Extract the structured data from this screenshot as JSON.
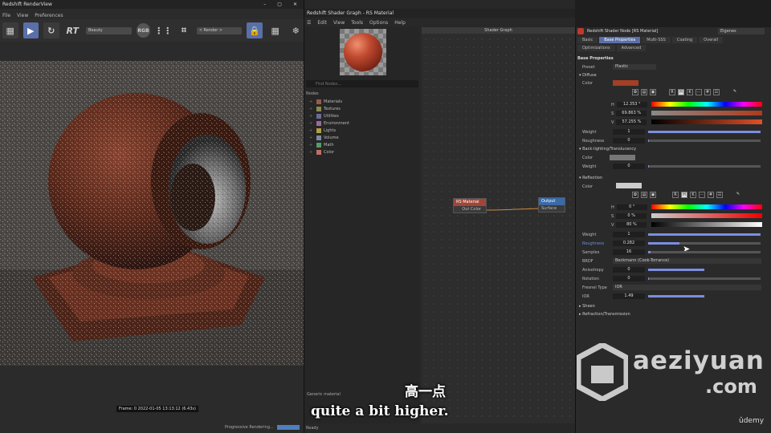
{
  "render_view": {
    "title": "Redshift RenderView",
    "menu": [
      "File",
      "View",
      "Preferences"
    ],
    "toolbar": {
      "rt_label": "RT",
      "beauty": "Beauty",
      "rgb": "RGB",
      "render_sel": "< Render >"
    },
    "frame_label": "Frame: 0  2022-01-05  13:13:12  (6.43s)",
    "progress_text": "Progressive Rendering...",
    "progress_value": "0%"
  },
  "shader_graph": {
    "title": "Redshift Shader Graph - RS Material",
    "menu": [
      "Edit",
      "View",
      "Tools",
      "Options",
      "Help"
    ],
    "canvas_title": "Shader Graph",
    "find_placeholder": "Find Nodes...",
    "nodes_header": "Nodes",
    "categories": [
      {
        "label": "Materials",
        "color": "#9a5a4a"
      },
      {
        "label": "Textures",
        "color": "#8a8a4a"
      },
      {
        "label": "Utilities",
        "color": "#6a6a9a"
      },
      {
        "label": "Environment",
        "color": "#9a6a9a"
      },
      {
        "label": "Lights",
        "color": "#b0a040"
      },
      {
        "label": "Volume",
        "color": "#7a8aa0"
      },
      {
        "label": "Math",
        "color": "#5a9a6a"
      },
      {
        "label": "Color",
        "color": "#c07060"
      }
    ],
    "node_material": {
      "title": "RS Material",
      "port": "Out Color"
    },
    "node_output": {
      "title": "Output",
      "port": "Surface"
    },
    "footer": "Generic material",
    "status": "Ready"
  },
  "attributes": {
    "title": "Redshift Shader Node [RS Material]",
    "mode": "Eigenes",
    "tabs": [
      "Basic",
      "Base Properties",
      "Multi-SSS",
      "Coating",
      "Overall",
      "Optimizations",
      "Advanced"
    ],
    "selected_tab": "Base Properties",
    "section": "Base Properties",
    "preset_label": "Preset",
    "preset_value": "Plastic",
    "diffuse": {
      "header": "Diffuse",
      "color_label": "Color",
      "color": "#a33f25",
      "h_label": "H",
      "h_value": "12.353 °",
      "s_label": "S",
      "s_value": "69.863 %",
      "v_label": "V",
      "v_value": "57.255 %",
      "weight_label": "Weight",
      "weight_value": "1",
      "roughness_label": "Roughness",
      "roughness_value": "0"
    },
    "backlighting": {
      "header": "Back-lighting/Translucency",
      "color_label": "Color",
      "weight_label": "Weight",
      "weight_value": "0"
    },
    "reflection": {
      "header": "Reflection",
      "color_label": "Color",
      "h_label": "H",
      "h_value": "0 °",
      "s_label": "S",
      "s_value": "0 %",
      "v_label": "V",
      "v_value": "80 %",
      "weight_label": "Weight",
      "weight_value": "1",
      "roughness_label": "Roughness",
      "roughness_value": "0.282",
      "samples_label": "Samples",
      "samples_value": "16",
      "brdf_label": "BRDF",
      "brdf_value": "Beckmann (Cook-Torrance)",
      "anisotropy_label": "Anisotropy",
      "anisotropy_value": "0",
      "rotation_label": "Rotation",
      "rotation_value": "0",
      "fresnel_label": "Fresnel Type",
      "fresnel_value": "IOR",
      "ior_label": "IOR",
      "ior_value": "1.49"
    },
    "sheen_header": "Sheen",
    "refraction_header": "Refraction/Transmission"
  },
  "subtitle": {
    "cn": "高一点",
    "en": "quite a bit higher."
  },
  "watermark": {
    "name": "aeziyuan",
    "tld": ".com"
  },
  "udemy": "ûdemy"
}
